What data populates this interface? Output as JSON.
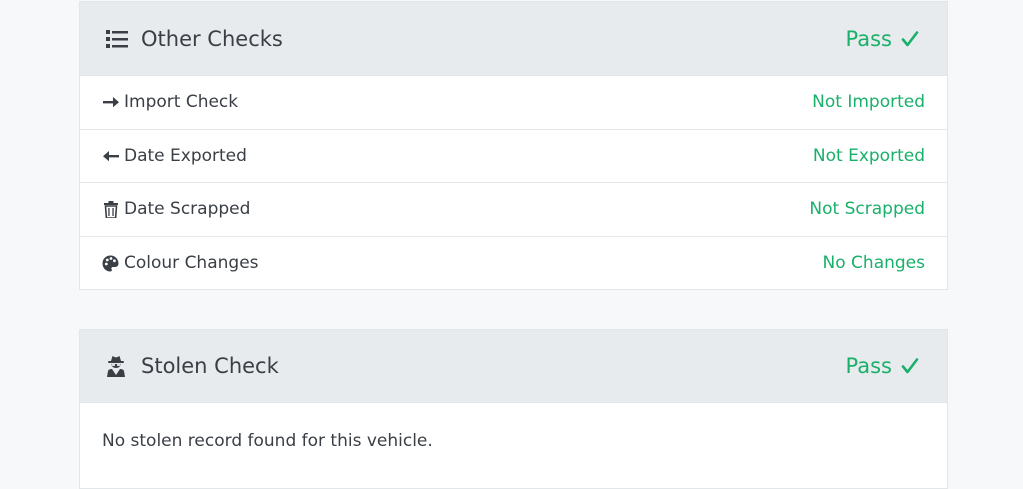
{
  "other_checks": {
    "title": "Other Checks",
    "status": "Pass",
    "rows": [
      {
        "icon": "arrow-right-icon",
        "label": "Import Check",
        "value": "Not Imported"
      },
      {
        "icon": "arrow-left-icon",
        "label": "Date Exported",
        "value": "Not Exported"
      },
      {
        "icon": "trash-icon",
        "label": "Date Scrapped",
        "value": "Not Scrapped"
      },
      {
        "icon": "palette-icon",
        "label": "Colour Changes",
        "value": "No Changes"
      }
    ]
  },
  "stolen_check": {
    "title": "Stolen Check",
    "status": "Pass",
    "message": "No stolen record found for this vehicle."
  },
  "colors": {
    "pass": "#19b06a",
    "header_bg": "#e8ebee",
    "text": "#3a3f45"
  }
}
